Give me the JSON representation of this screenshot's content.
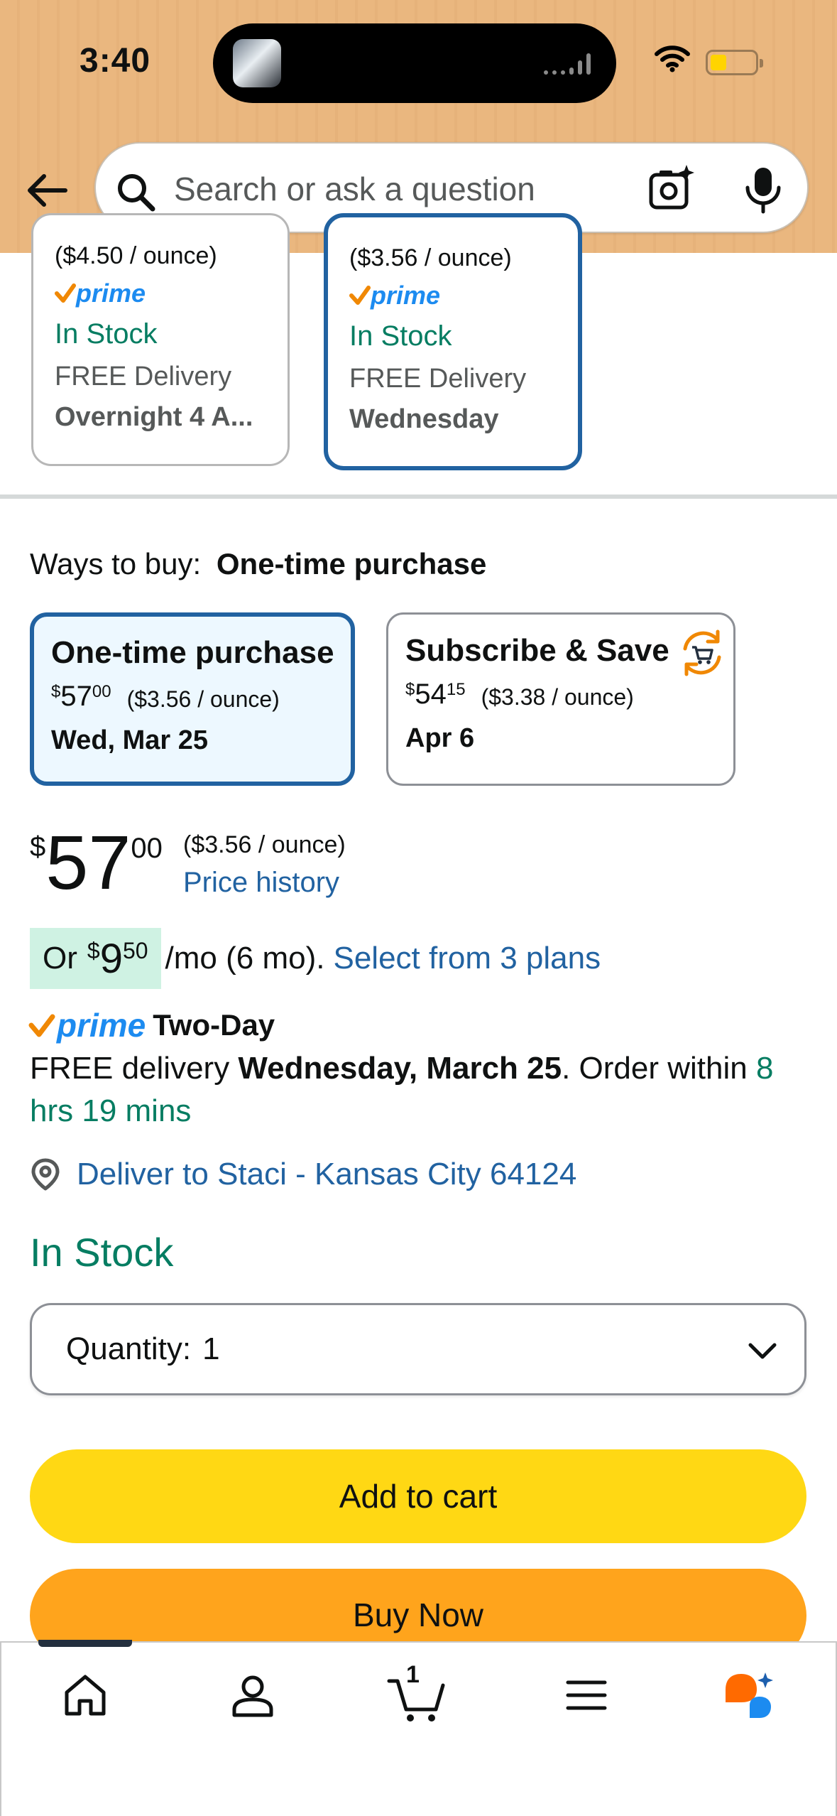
{
  "status_bar": {
    "time": "3:40"
  },
  "search": {
    "placeholder": "Search or ask a question"
  },
  "offer_cards": [
    {
      "unit_price": "($4.50 / ounce)",
      "prime": "prime",
      "stock": "In Stock",
      "delivery": "FREE Delivery",
      "delivery_when": "Overnight 4 A..."
    },
    {
      "unit_price": "($3.56 / ounce)",
      "prime": "prime",
      "stock": "In Stock",
      "delivery": "FREE Delivery",
      "delivery_when": "Wednesday"
    }
  ],
  "ways_to_buy": {
    "label": "Ways to buy:",
    "selected": "One-time purchase",
    "options": [
      {
        "title": "One-time purchase",
        "currency": "$",
        "price_whole": "57",
        "price_fraction": "00",
        "unit_price": "($3.56 / ounce)",
        "date": "Wed, Mar 25"
      },
      {
        "title": "Subscribe & Save",
        "currency": "$",
        "price_whole": "54",
        "price_fraction": "15",
        "unit_price": "($3.38 / ounce)",
        "date": "Apr 6"
      }
    ]
  },
  "price": {
    "currency": "$",
    "whole": "57",
    "fraction": "00",
    "unit_price": "($3.56 / ounce)",
    "history_link": "Price history"
  },
  "monthly": {
    "prefix": "Or",
    "currency": "$",
    "whole": "9",
    "fraction": "50",
    "suffix": "/mo (6 mo).",
    "plans_link": "Select from 3 plans"
  },
  "shipping": {
    "prime": "prime",
    "speed": "Two-Day",
    "text_start": "FREE delivery",
    "date": "Wednesday, March 25",
    "text_mid": ". Order within",
    "countdown": "8 hrs 19 mins"
  },
  "deliver_to": "Deliver to Staci - Kansas City 64124",
  "stock": "In Stock",
  "quantity": {
    "label": "Quantity:",
    "value": "1"
  },
  "buttons": {
    "add_to_cart": "Add to cart",
    "buy_now": "Buy Now"
  },
  "tabbar": {
    "cart_count": "1"
  },
  "colors": {
    "header": "#eab77f",
    "link": "#2162a1",
    "in_stock": "#067d62",
    "add_to_cart": "#ffd814",
    "buy_now": "#ffa41c",
    "prime_blue": "#1c8bf0",
    "prime_check": "#f08804"
  }
}
